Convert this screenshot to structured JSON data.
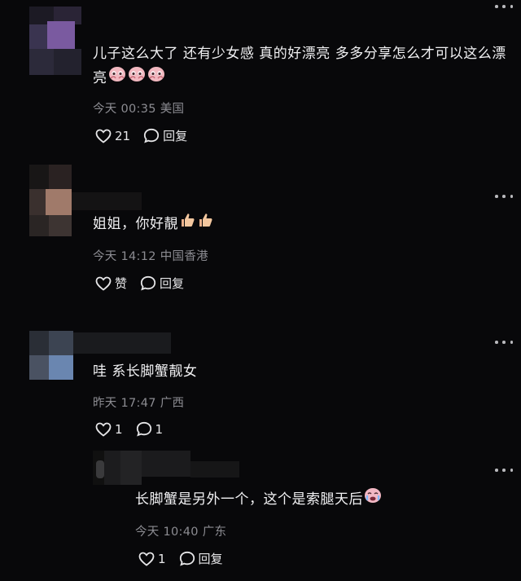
{
  "comments": [
    {
      "text": "儿子这么大了 还有少女感 真的好漂亮 多多分享怎么才可以这么漂亮",
      "emoji": [
        "pleading-face-icon",
        "pleading-face-icon",
        "pleading-face-icon"
      ],
      "time": "今天 00:35",
      "location": "美国",
      "likes": "21",
      "reply_label": "回复"
    },
    {
      "text": "姐姐，你好靚",
      "emoji": [
        "thumbs-up-icon",
        "thumbs-up-icon"
      ],
      "time": "今天 14:12",
      "location": "中国香港",
      "likes": "赞",
      "reply_label": "回复"
    },
    {
      "text": "哇 系长脚蟹靓女",
      "time": "昨天 17:47",
      "location": "广西",
      "likes": "1",
      "replies": "1"
    },
    {
      "text": "长脚蟹是另外一个，这个是索腿天后",
      "emoji": [
        "crying-face-icon"
      ],
      "time": "今天 10:40",
      "location": "广东",
      "likes": "1",
      "reply_label": "回复"
    }
  ],
  "colors": {
    "background": "#08080a",
    "meta": "#8c8c92",
    "text": "#f1f1f3"
  }
}
